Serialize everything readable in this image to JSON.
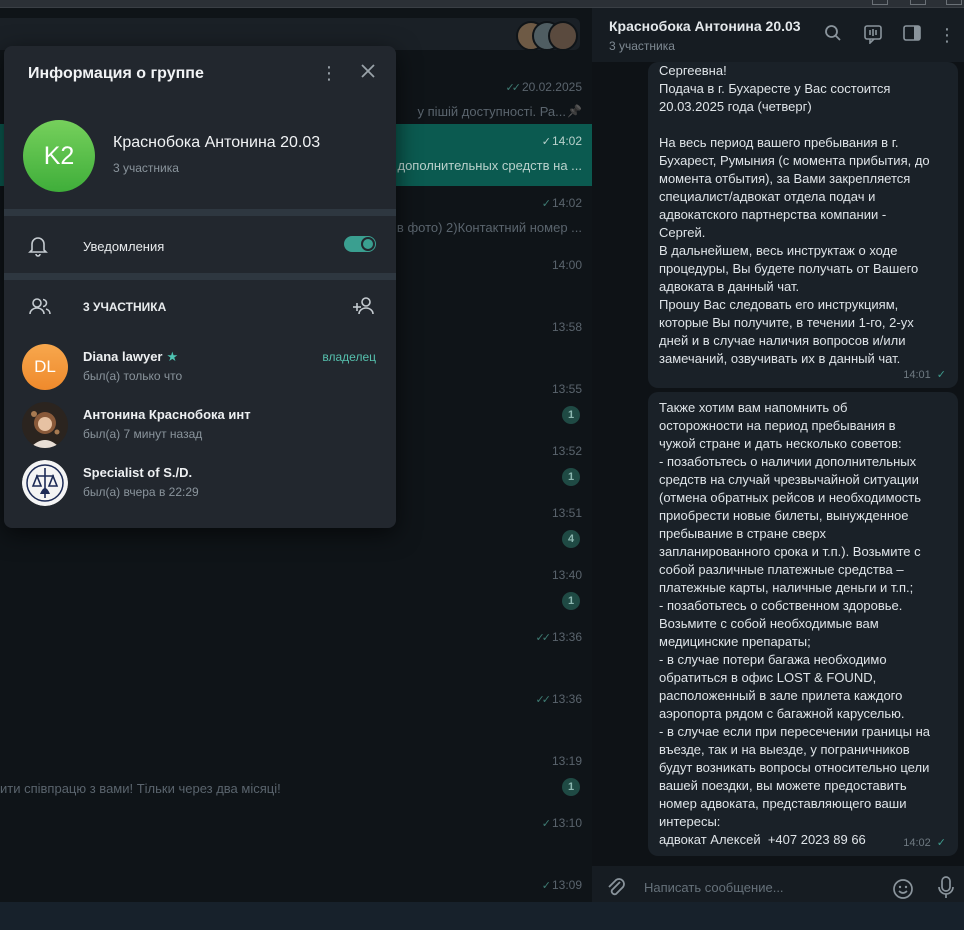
{
  "chat_list": {
    "rows": [
      {
        "time": "20.02.2025",
        "preview": "у пішій доступності.  Ра...",
        "badge": "",
        "check": "double",
        "active": false
      },
      {
        "time": "14:02",
        "preview": "дополнительных средств на ...",
        "badge": "",
        "check": "single",
        "active": true
      },
      {
        "time": "14:02",
        "preview": "в фото) 2)Контактний номер ...",
        "badge": "",
        "check": "single",
        "active": false
      },
      {
        "time": "14:00",
        "preview": "",
        "badge": "",
        "check": "",
        "active": false
      },
      {
        "time": "13:58",
        "preview": "",
        "badge": "",
        "check": "",
        "active": false
      },
      {
        "time": "13:55",
        "preview": "",
        "badge": "1",
        "check": "",
        "active": false
      },
      {
        "time": "13:52",
        "preview": "",
        "badge": "1",
        "check": "",
        "active": false
      },
      {
        "time": "13:51",
        "preview": "",
        "badge": "4",
        "check": "",
        "active": false
      },
      {
        "time": "13:40",
        "preview": "",
        "badge": "1",
        "check": "",
        "active": false
      },
      {
        "time": "13:36",
        "preview": "",
        "badge": "",
        "check": "double",
        "active": false
      },
      {
        "time": "13:36",
        "preview": "",
        "badge": "",
        "check": "double",
        "active": false
      },
      {
        "time": "13:19",
        "preview": "",
        "badge": "1",
        "check": "",
        "active": false
      },
      {
        "time": "13:10",
        "preview": "",
        "badge": "",
        "check": "single",
        "active": false
      },
      {
        "time": "13:09",
        "preview": "",
        "badge": "",
        "check": "single",
        "active": false
      }
    ],
    "snippet_1319": "ити співпрацю з вами! Тільки через два місяці!"
  },
  "chat": {
    "title": "Краснобока Антонина 20.03",
    "subtitle": "3 участника",
    "messages": [
      {
        "text": "Сергеевна!\nПодача в г. Бухаресте у Вас состоится\n20.03.2025 года (четверг)\n\nНа весь период вашего пребывания в г.\nБухарест, Румыния (с момента прибытия, до\nмомента отбытия), за Вами закрепляется\nспециалист/адвокат отдела подач и\nадвокатского партнерства компании -\nСергей.\nВ дальнейшем, весь инструктаж о ходе\nпроцедуры, Вы будете получать от Вашего\nадвоката в данный чат.\nПрошу Вас следовать его инструкциям,\nкоторые Вы получите, в течении 1-го, 2-ух\nдней и в случае наличия вопросов и/или\nзамечаний, озвучивать их в данный чат.",
        "time": "14:01"
      },
      {
        "text": "Также хотим вам напомнить об\nосторожности на период пребывания в\nчужой стране и дать несколько советов:\n- позаботьтесь о наличии дополнительных\nсредств на случай чрезвычайной ситуации\n(отмена обратных рейсов и необходимость\nприобрести новые билеты, вынужденное\nпребывание в стране сверх\nзапланированного срока и т.п.). Возьмите с\nсобой различные платежные средства –\nплатежные карты, наличные деньги и т.п.;\n- позаботьтесь о собственном здоровье.\nВозьмите с собой необходимые вам\nмедицинские препараты;\n- в случае потери багажа необходимо\nобратиться в офис LOST & FOUND,\nрасположенный в зале прилета каждого\nаэропорта рядом с багажной каруселью.\n- в случае если при пересечении границы на\nвъезде, так и на выезде, у пограничников\nбудут возникать вопросы относительно цели\nвашей поездки, вы можете предоставить\nномер адвоката, представляющего ваши\nинтересы:\nадвокат Алексей  +407 2023 89 66",
        "time": "14:02"
      }
    ],
    "input_placeholder": "Написать сообщение..."
  },
  "info_panel": {
    "title": "Информация о группе",
    "group_initials": "K2",
    "group_name": "Краснобока Антонина 20.03",
    "group_members_count": "3 участника",
    "notifications_label": "Уведомления",
    "notifications_on": true,
    "members_header": "3 УЧАСТНИКА",
    "members": [
      {
        "initials": "DL",
        "name": "Diana lawyer",
        "status": "был(а) только что",
        "role": "владелец",
        "star": true
      },
      {
        "initials": "",
        "name": "Антонина Краснобока инт",
        "status": "был(а) 7 минут назад",
        "role": "",
        "star": false
      },
      {
        "initials": "",
        "name": "Specialist of S./D.",
        "status": "был(а) вчера в 22:29",
        "role": "",
        "star": false
      }
    ]
  },
  "colors": {
    "accent": "#3a9f90",
    "owner": "#56c1ae",
    "group_avatar": "#5cc04a",
    "diana_avatar": "#f39a3c"
  },
  "icons": [
    "search-icon",
    "video-chat-icon",
    "sidebar-toggle-icon",
    "more-vertical-icon",
    "close-icon",
    "bell-icon",
    "members-icon",
    "add-member-icon",
    "attach-icon",
    "emoji-icon",
    "microphone-icon",
    "double-check-icon",
    "pin-icon"
  ]
}
